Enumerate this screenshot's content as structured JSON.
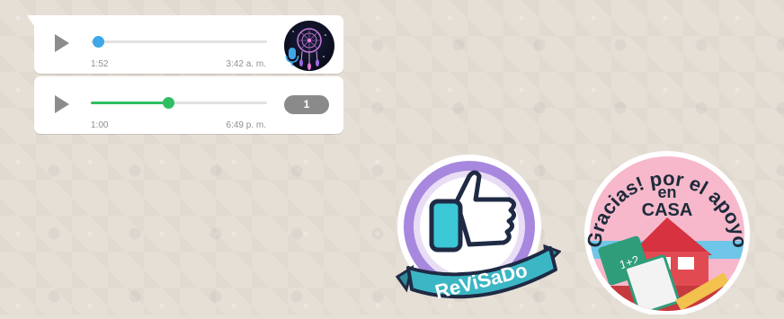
{
  "chat": {
    "messages": [
      {
        "type": "voice",
        "duration": "1:52",
        "timestamp": "3:42 a. m.",
        "progress": 0.04,
        "accent_color": "#3fa7e8",
        "avatar_icon": "dreamcatcher-avatar",
        "status_icon": "microphone-icon"
      },
      {
        "type": "voice",
        "duration": "1:00",
        "timestamp": "6:49 p. m.",
        "progress": 0.44,
        "accent_color": "#2fbf62",
        "speed_label": "1"
      }
    ],
    "stickers": [
      {
        "name": "revisado-thumbs-up-sticker",
        "text": "ReViSaDo"
      },
      {
        "name": "gracias-apoyo-sticker",
        "arc_text": "Gracias! por el apoyo",
        "center_text_1": "en",
        "center_text_2": "CASA",
        "board_text": "1+2"
      }
    ]
  }
}
